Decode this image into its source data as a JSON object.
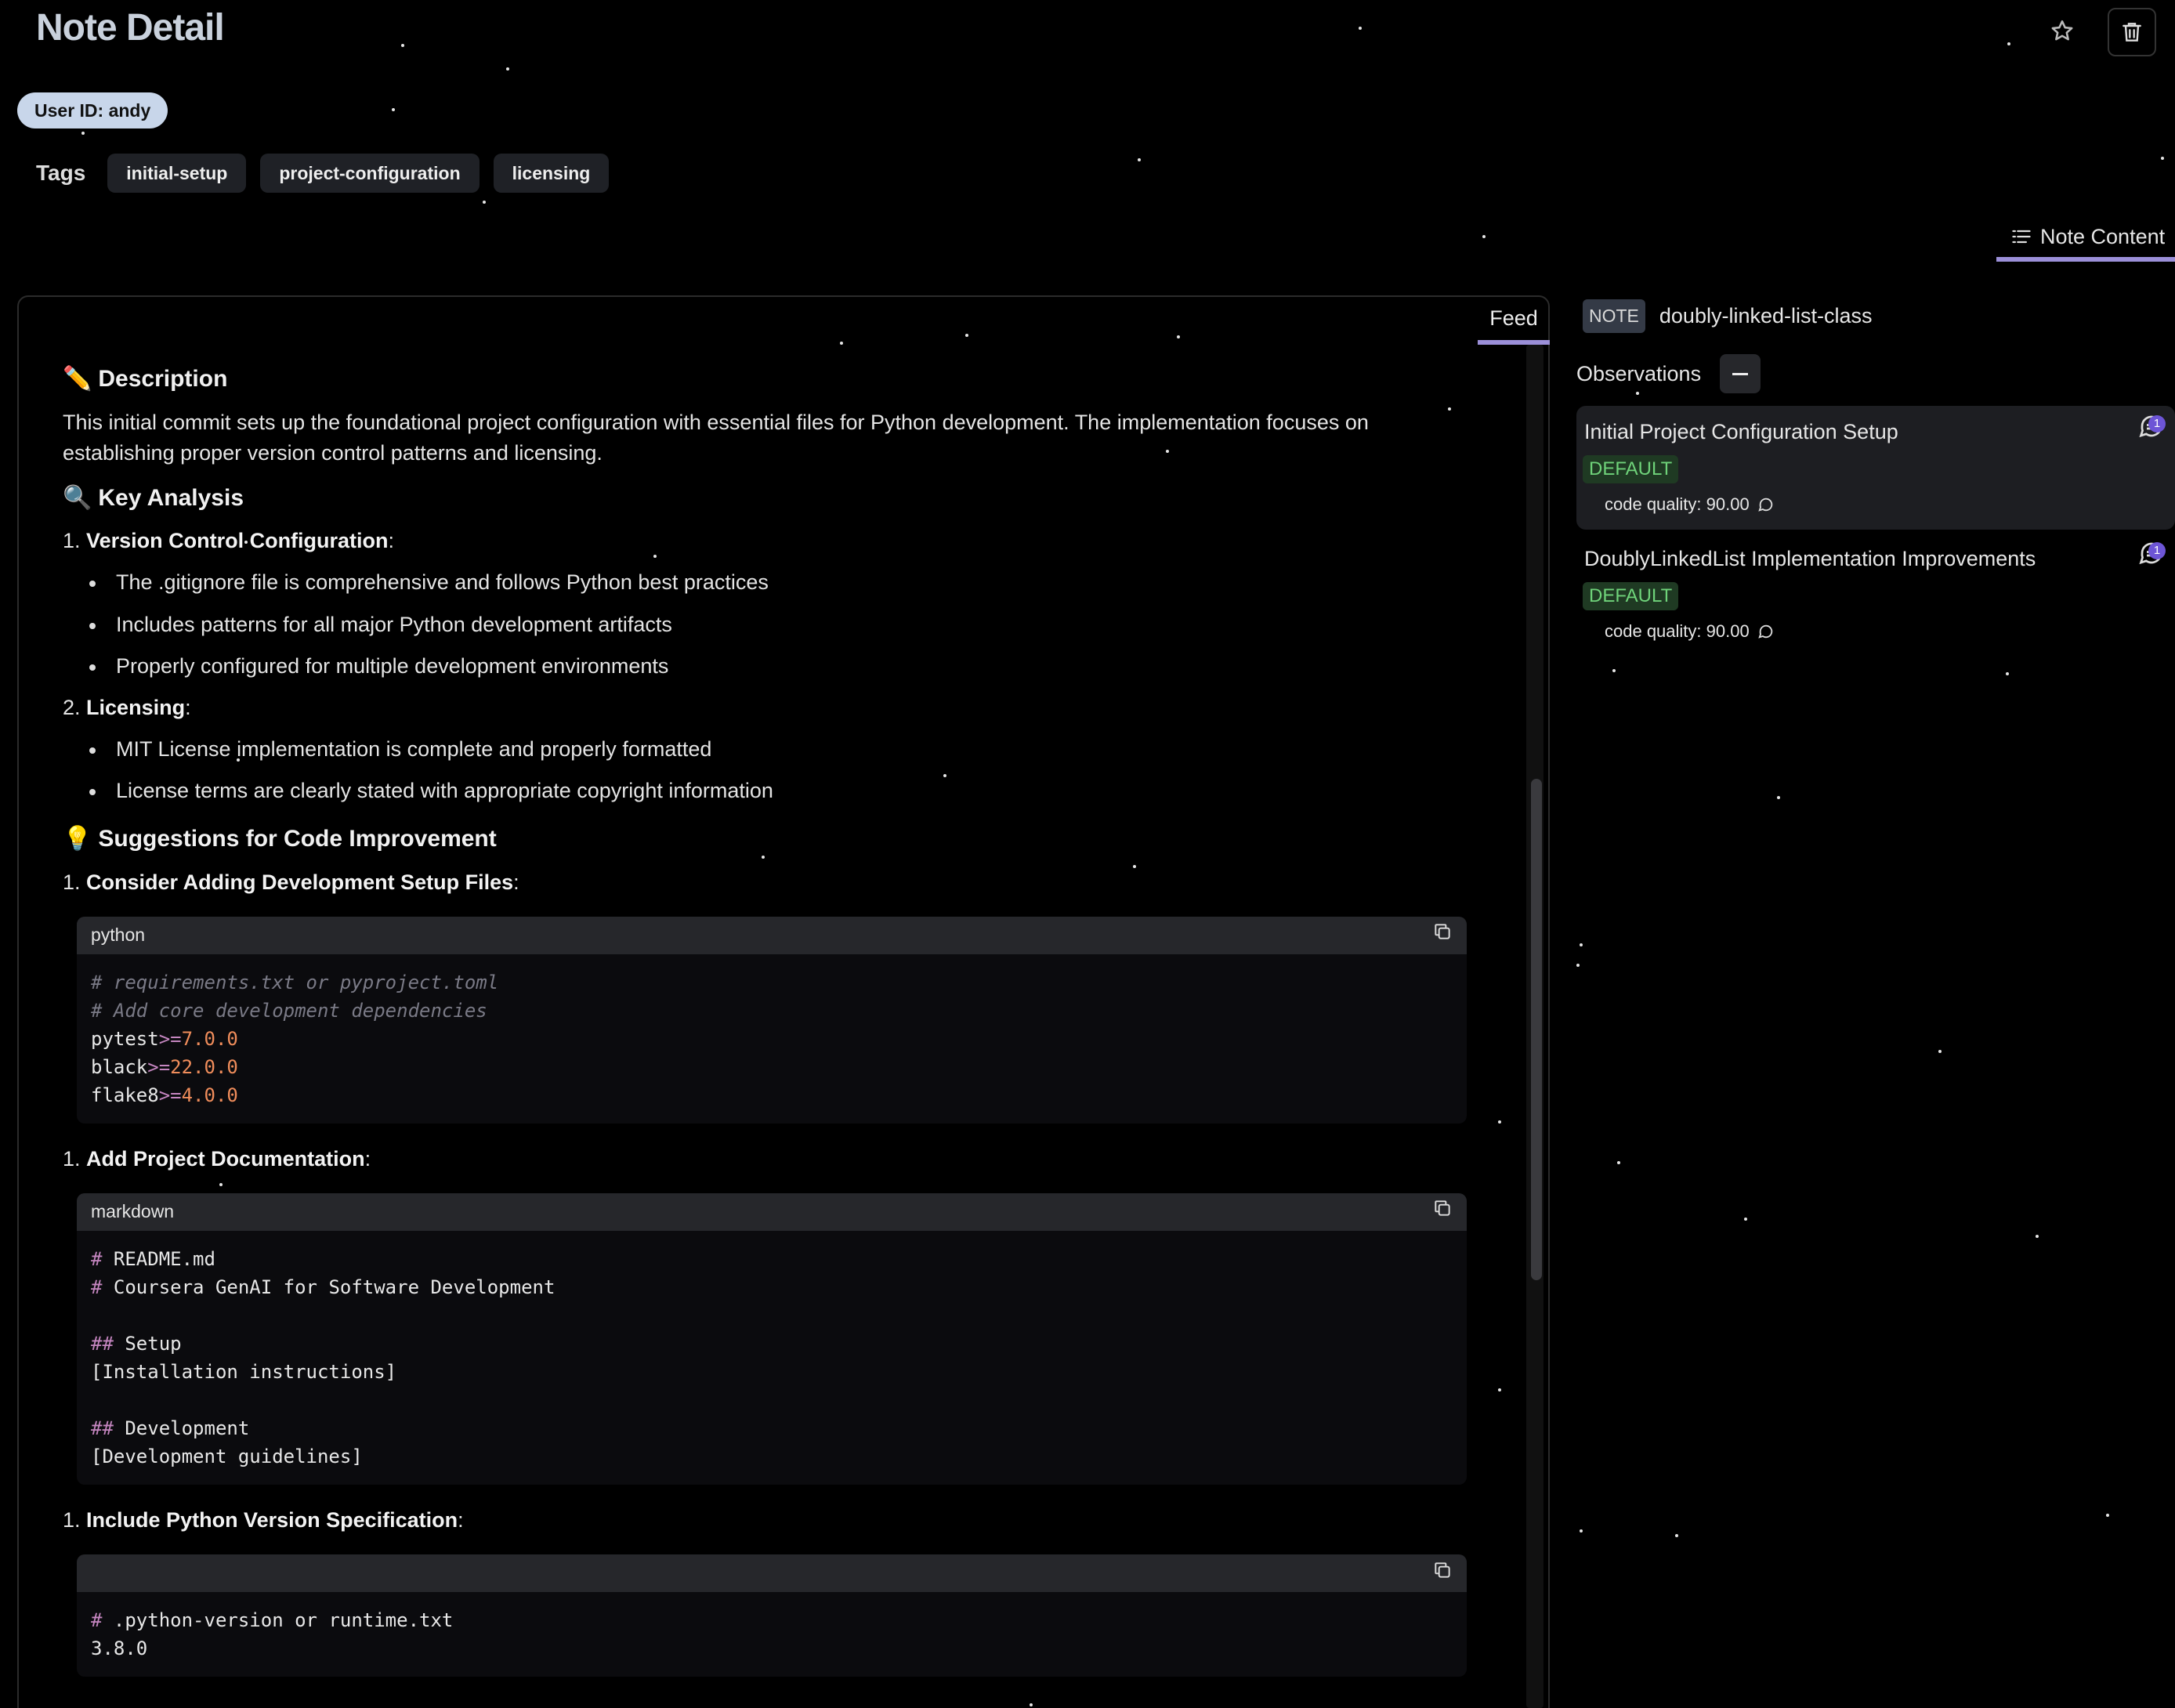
{
  "header": {
    "title": "Note Detail",
    "user_badge": "User ID: andy"
  },
  "tags": {
    "label": "Tags",
    "items": [
      "initial-setup",
      "project-configuration",
      "licensing"
    ]
  },
  "tabs": {
    "note_content": "Note Content",
    "feed": "Feed"
  },
  "feed": {
    "description_heading": "Description",
    "description_text": "This initial commit sets up the foundational project configuration with essential files for Python development. The implementation focuses on establishing proper version control patterns and licensing.",
    "key_analysis_heading": "Key Analysis",
    "analysis": [
      {
        "number": "1.",
        "title": "Version Control Configuration",
        "bullets": [
          "The .gitignore file is comprehensive and follows Python best practices",
          "Includes patterns for all major Python development artifacts",
          "Properly configured for multiple development environments"
        ]
      },
      {
        "number": "2.",
        "title": "Licensing",
        "bullets": [
          "MIT License implementation is complete and properly formatted",
          "License terms are clearly stated with appropriate copyright information"
        ]
      }
    ],
    "suggestions_heading": "Suggestions for Code Improvement",
    "suggestions": [
      {
        "number": "1.",
        "title": "Consider Adding Development Setup Files",
        "code_lang": "python",
        "code_lines": [
          "# requirements.txt or pyproject.toml",
          "# Add core development dependencies",
          "pytest>=7.0.0",
          "black>=22.0.0",
          "flake8>=4.0.0"
        ]
      },
      {
        "number": "1.",
        "title": "Add Project Documentation",
        "code_lang": "markdown",
        "code_lines": [
          "# README.md",
          "# Coursera GenAI for Software Development",
          "",
          "## Setup",
          "[Installation instructions]",
          "",
          "## Development",
          "[Development guidelines]"
        ]
      },
      {
        "number": "1.",
        "title": "Include Python Version Specification",
        "code_lang": "",
        "code_lines": [
          "# .python-version or runtime.txt",
          "3.8.0"
        ]
      }
    ]
  },
  "note": {
    "chip": "NOTE",
    "name": "doubly-linked-list-class",
    "observations_label": "Observations",
    "observations": [
      {
        "title": "Initial Project Configuration Setup",
        "badge": "DEFAULT",
        "metric": "code quality: 90.00",
        "comment_count": "1",
        "active": true
      },
      {
        "title": "DoublyLinkedList Implementation Improvements",
        "badge": "DEFAULT",
        "metric": "code quality: 90.00",
        "comment_count": "1",
        "active": false
      }
    ]
  },
  "icons": {
    "star": "star-icon",
    "trash": "trash-icon",
    "list": "list-icon",
    "copy": "copy-icon",
    "pencil": "pencil-icon",
    "magnifier": "magnifier-icon",
    "bulb": "lightbulb-icon",
    "comment": "comment-icon",
    "collapse": "minus-icon"
  },
  "colors": {
    "accent": "#9b8fd8",
    "badge_green": "#6fd37a",
    "count_badge": "#6d55d6"
  }
}
